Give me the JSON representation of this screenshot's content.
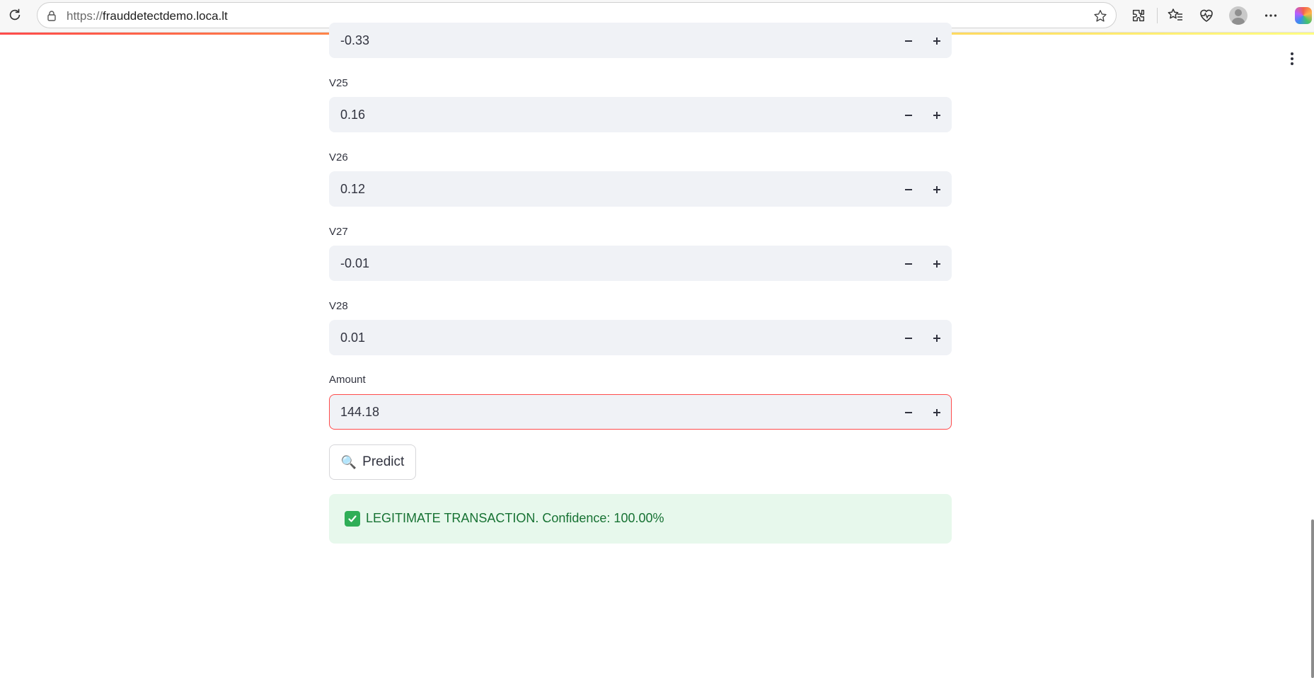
{
  "browser": {
    "url_protocol": "https://",
    "url_host": "frauddetectdemo.loca.lt",
    "icons": [
      "reload-icon",
      "lock-icon",
      "star-icon",
      "extensions-icon",
      "favorites-icon",
      "health-icon",
      "profile-avatar",
      "more-icon",
      "copilot-icon"
    ]
  },
  "form": {
    "top_partial_value": "-0.33",
    "fields": [
      {
        "label": "V25",
        "value": "0.16"
      },
      {
        "label": "V26",
        "value": "0.12"
      },
      {
        "label": "V27",
        "value": "-0.01"
      },
      {
        "label": "V28",
        "value": "0.01"
      },
      {
        "label": "Amount",
        "value": "144.18"
      }
    ],
    "predict_button": {
      "icon": "🔍",
      "label": "Predict"
    }
  },
  "result": {
    "icon": "✅",
    "text": "LEGITIMATE TRANSACTION. Confidence: 100.00%",
    "colors": {
      "background": "#e7f8ec",
      "text": "#177233"
    }
  },
  "colors": {
    "accent": "#ff4b4b",
    "input_bg": "#f0f2f6"
  }
}
